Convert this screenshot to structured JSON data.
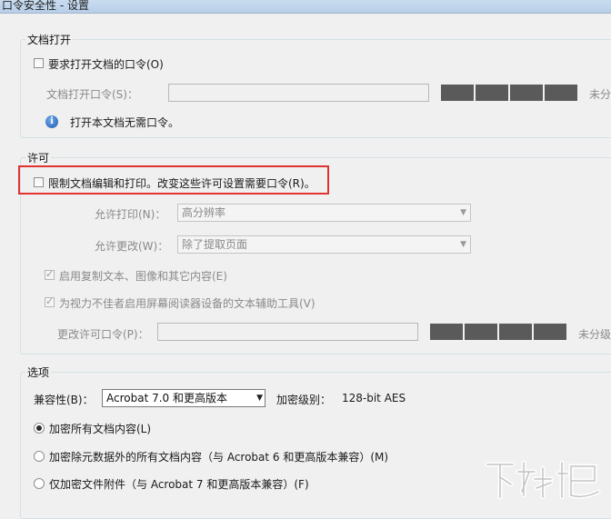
{
  "window": {
    "title": "口令安全性 - 设置"
  },
  "doc_open": {
    "group_title": "文档打开",
    "require_password_label": "要求打开文档的口令(O)",
    "password_label": "文档打开口令(S)：",
    "strength_text": "未分",
    "info_text": "打开本文档无需口令。"
  },
  "permissions": {
    "group_title": "许可",
    "restrict_label": "限制文档编辑和打印。改变这些许可设置需要口令(R)。",
    "print_label": "允许打印(N)：",
    "print_value": "高分辨率",
    "change_label": "允许更改(W)：",
    "change_value": "除了提取页面",
    "copy_label": "启用复制文本、图像和其它内容(E)",
    "accessibility_label": "为视力不佳者启用屏幕阅读器设备的文本辅助工具(V)",
    "change_password_label": "更改许可口令(P)：",
    "strength_text": "未分级"
  },
  "options": {
    "group_title": "选项",
    "compat_label": "兼容性(B)：",
    "compat_value": "Acrobat 7.0 和更高版本",
    "encryption_label": "加密级别：",
    "encryption_value": "128-bit AES",
    "radio_all": "加密所有文档内容(L)",
    "radio_except_metadata": "加密除元数据外的所有文档内容（与 Acrobat 6 和更高版本兼容）(M)",
    "radio_attachments": "仅加密文件附件（与 Acrobat 7 和更高版本兼容）(F)"
  },
  "watermark": {
    "text": "下载吧"
  },
  "colors": {
    "highlight": "#e0332f",
    "meter": "#5a5a5a"
  }
}
